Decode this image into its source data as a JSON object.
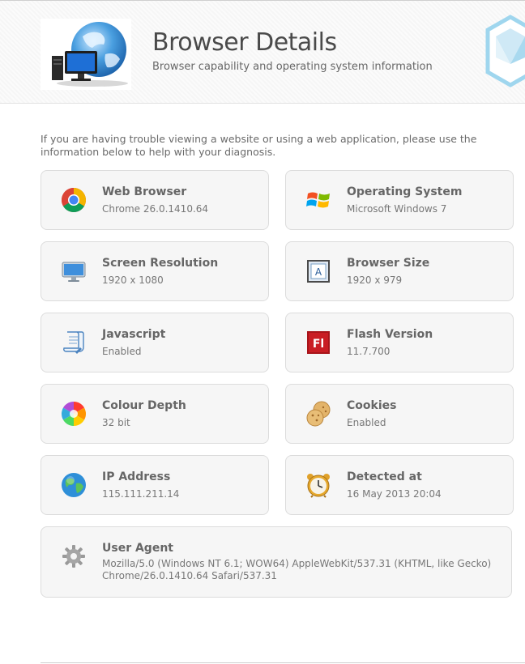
{
  "header": {
    "title": "Browser Details",
    "subtitle": "Browser capability and operating system information"
  },
  "intro_text": "If you are having trouble viewing a website or using a web application, please use the information below to help with your diagnosis.",
  "cards": {
    "web_browser": {
      "label": "Web Browser",
      "value": "Chrome 26.0.1410.64",
      "icon": "chrome-icon"
    },
    "operating_system": {
      "label": "Operating System",
      "value": "Microsoft Windows 7",
      "icon": "windows-icon"
    },
    "screen_resolution": {
      "label": "Screen Resolution",
      "value": "1920 x 1080",
      "icon": "monitor-icon"
    },
    "browser_size": {
      "label": "Browser Size",
      "value": "1920 x 979",
      "icon": "browser-window-icon"
    },
    "javascript": {
      "label": "Javascript",
      "value": "Enabled",
      "icon": "script-icon"
    },
    "flash_version": {
      "label": "Flash Version",
      "value": "11.7.700",
      "icon": "flash-icon"
    },
    "colour_depth": {
      "label": "Colour Depth",
      "value": "32 bit",
      "icon": "color-wheel-icon"
    },
    "cookies": {
      "label": "Cookies",
      "value": "Enabled",
      "icon": "cookie-icon"
    },
    "ip_address": {
      "label": "IP Address",
      "value": "115.111.211.14",
      "icon": "globe-icon"
    },
    "detected_at": {
      "label": "Detected at",
      "value": "16 May 2013 20:04",
      "icon": "alarm-clock-icon"
    },
    "user_agent": {
      "label": "User Agent",
      "value": "Mozilla/5.0 (Windows NT 6.1; WOW64) AppleWebKit/537.31 (KHTML, like Gecko) Chrome/26.0.1410.64 Safari/537.31",
      "icon": "gear-icon"
    }
  },
  "colors": {
    "card_background": "#f6f6f6",
    "card_border": "#dcdcdc",
    "title_text": "#4a4a4a",
    "label_text": "#666666"
  }
}
